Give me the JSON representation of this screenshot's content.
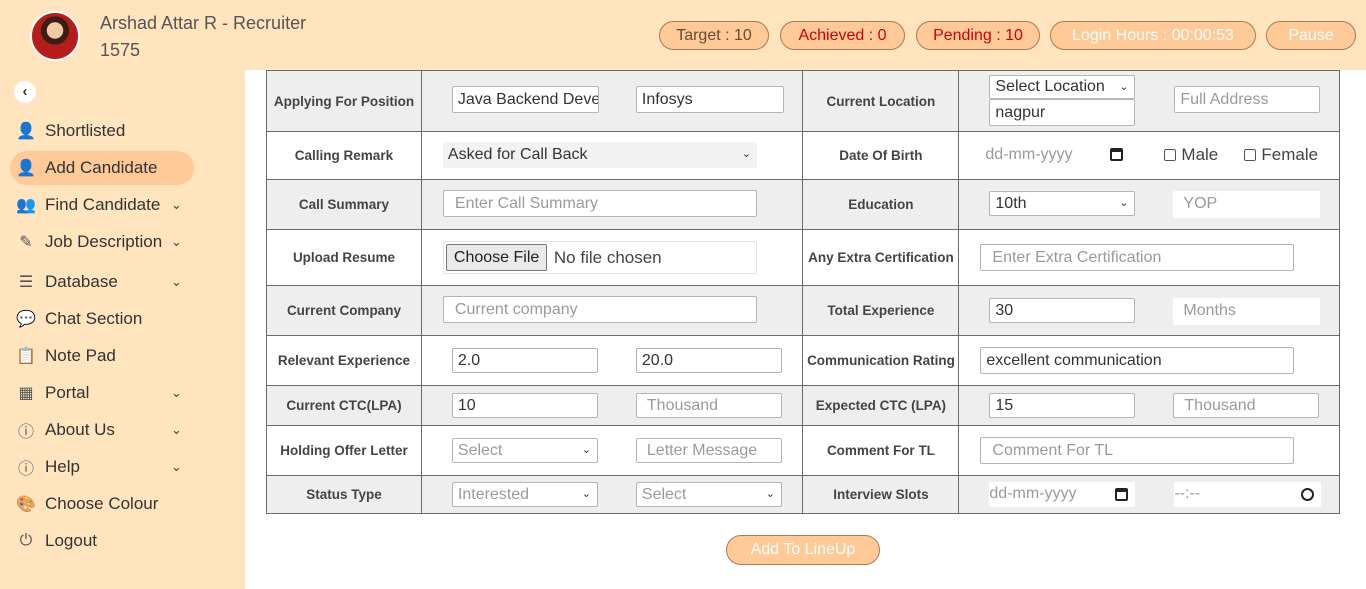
{
  "header": {
    "user_name": "Arshad Attar R - Recruiter",
    "user_id": "1575",
    "target": "Target : 10",
    "achieved": "Achieved : 0",
    "pending": "Pending : 10",
    "login_hours": "Login Hours : 00:00:53",
    "pause": "Pause"
  },
  "sidebar": {
    "items": [
      {
        "label": "Shortlisted"
      },
      {
        "label": "Add Candidate"
      },
      {
        "label": "Find Candidate"
      },
      {
        "label": "Job Description"
      },
      {
        "label": "Database"
      },
      {
        "label": "Chat Section"
      },
      {
        "label": "Note Pad"
      },
      {
        "label": "Portal"
      },
      {
        "label": "About Us"
      },
      {
        "label": "Help"
      },
      {
        "label": "Choose Colour"
      },
      {
        "label": "Logout"
      }
    ]
  },
  "form": {
    "applying_for_position": {
      "label": "Applying For Position",
      "value": "Java Backend Deve",
      "company": "Infosys"
    },
    "current_location": {
      "label": "Current Location",
      "select": "Select Location",
      "city": "nagpur",
      "address_placeholder": "Full Address"
    },
    "calling_remark": {
      "label": "Calling Remark",
      "value": "Asked for Call Back"
    },
    "date_of_birth": {
      "label": "Date Of Birth",
      "placeholder": "dd-mm-yyyy",
      "male": "Male",
      "female": "Female"
    },
    "call_summary": {
      "label": "Call Summary",
      "placeholder": "Enter Call Summary"
    },
    "education": {
      "label": "Education",
      "value": "10th",
      "yop_placeholder": "YOP"
    },
    "upload_resume": {
      "label": "Upload Resume",
      "button": "Choose File",
      "status": "No file chosen"
    },
    "extra_certification": {
      "label": "Any Extra Certification",
      "placeholder": "Enter Extra Certification"
    },
    "current_company": {
      "label": "Current Company",
      "placeholder": "Current company"
    },
    "total_experience": {
      "label": "Total Experience",
      "value": "30",
      "months_placeholder": "Months"
    },
    "relevant_experience": {
      "label": "Relevant Experience",
      "value1": "2.0",
      "value2": "20.0"
    },
    "communication_rating": {
      "label": "Communication Rating",
      "value": "excellent communication"
    },
    "current_ctc": {
      "label": "Current CTC(LPA)",
      "value": "10",
      "thousand_placeholder": "Thousand"
    },
    "expected_ctc": {
      "label": "Expected CTC (LPA)",
      "value": "15",
      "thousand_placeholder": "Thousand"
    },
    "holding_offer_letter": {
      "label": "Holding Offer Letter",
      "select": "Select",
      "message_placeholder": "Letter Message"
    },
    "comment_for_tl": {
      "label": "Comment For TL",
      "placeholder": "Comment For TL"
    },
    "status_type": {
      "label": "Status Type",
      "value": "Interested",
      "select": "Select"
    },
    "interview_slots": {
      "label": "Interview Slots",
      "date_placeholder": "dd-mm-yyyy",
      "time_placeholder": "--:--"
    }
  },
  "actions": {
    "add_to_lineup": "Add To LineUp"
  },
  "colors": {
    "header_bg": "#ffe4bd",
    "accent": "#ffc998",
    "row_gray": "#eeeeee"
  }
}
